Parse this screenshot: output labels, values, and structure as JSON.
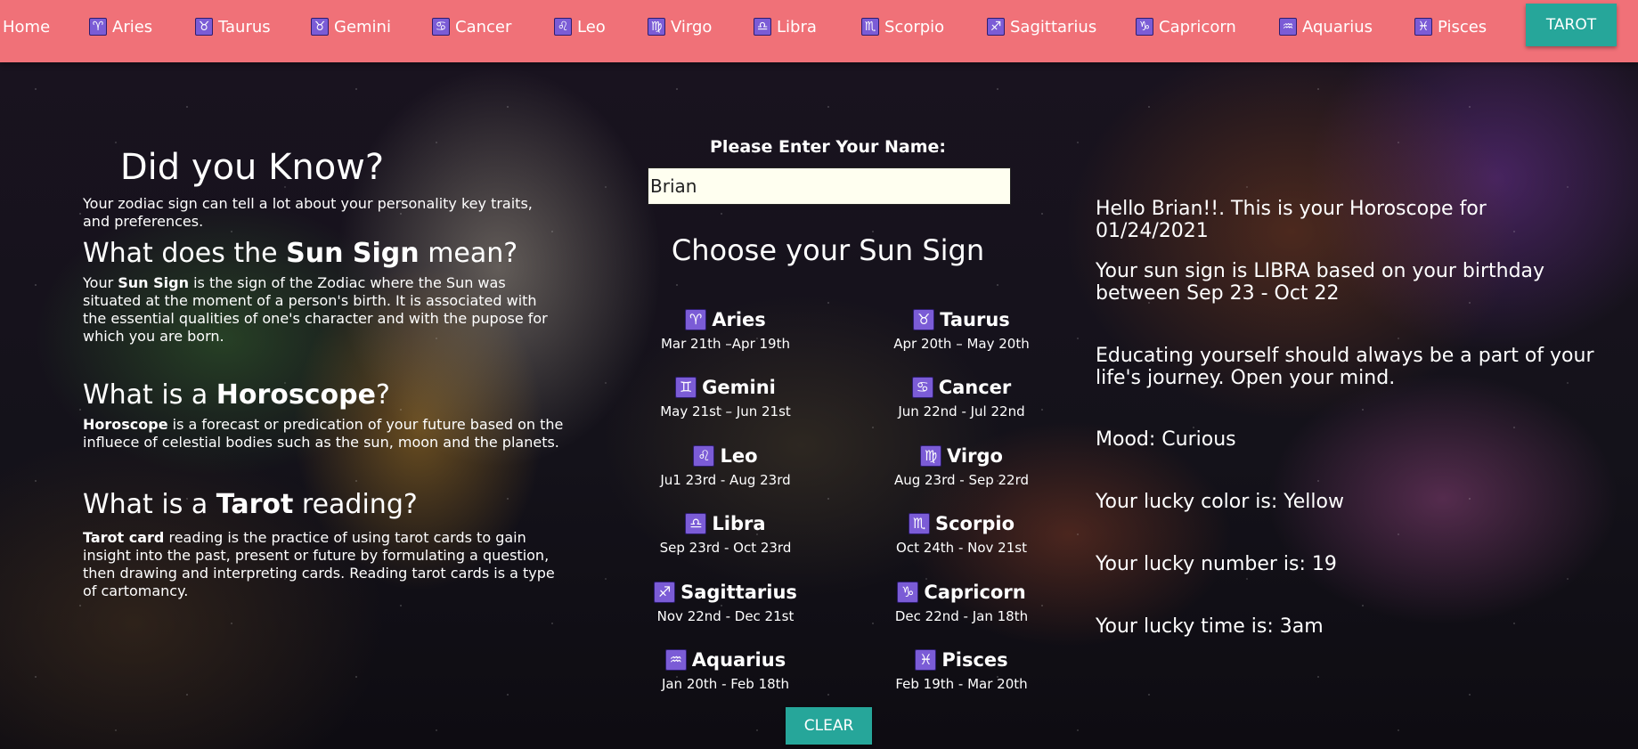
{
  "nav": {
    "home": "Home",
    "signs": [
      {
        "label": "Aries",
        "glyph": "♈"
      },
      {
        "label": "Taurus",
        "glyph": "♉"
      },
      {
        "label": "Gemini",
        "glyph": "♉"
      },
      {
        "label": "Cancer",
        "glyph": "♋"
      },
      {
        "label": "Leo",
        "glyph": "♌"
      },
      {
        "label": "Virgo",
        "glyph": "♍"
      },
      {
        "label": "Libra",
        "glyph": "♎"
      },
      {
        "label": "Scorpio",
        "glyph": "♏"
      },
      {
        "label": "Sagittarius",
        "glyph": "♐"
      },
      {
        "label": "Capricorn",
        "glyph": "♑"
      },
      {
        "label": "Aquarius",
        "glyph": "♒"
      },
      {
        "label": "Pisces",
        "glyph": "♓"
      }
    ],
    "tarot": "TAROT",
    "bar_color": "#f07178",
    "button_color": "#26a69a",
    "icon_color": "#7b5cd6"
  },
  "info": {
    "title": "Did you Know?",
    "intro": "Your zodiac sign can tell a lot about your personality key traits, and preferences.",
    "sun_heading_pre": "What does the ",
    "sun_heading_bold": "Sun Sign",
    "sun_heading_post": " mean?",
    "sun_text_pre": "Your ",
    "sun_text_bold": "Sun Sign",
    "sun_text_post": " is the sign of the Zodiac where the Sun was situated at the moment of a person's birth. It is associated with the essential qualities of one's character and with the pupose for which you are born.",
    "horo_heading_pre": "What is a ",
    "horo_heading_bold": "Horoscope",
    "horo_heading_post": "?",
    "horo_text_bold": "Horoscope",
    "horo_text_post": " is a forecast or predication of your future based on the influece of celestial bodies such as the sun, moon and the planets.",
    "tarot_heading_pre": "What is a ",
    "tarot_heading_bold": "Tarot",
    "tarot_heading_post": " reading?",
    "tarot_text_bold": "Tarot card",
    "tarot_text_post": " reading is the practice of using tarot cards to gain insight into the past, present or future by formulating a question, then drawing and interpreting cards. Reading tarot cards is a type of cartomancy."
  },
  "form": {
    "name_label": "Please Enter Your Name:",
    "name_value": "Brian",
    "choose_title": "Choose your Sun Sign",
    "clear": "CLEAR"
  },
  "signs": [
    {
      "name": "Aries",
      "glyph": "♈",
      "dates": "Mar 21th –Apr 19th"
    },
    {
      "name": "Taurus",
      "glyph": "♉",
      "dates": "Apr 20th – May 20th"
    },
    {
      "name": "Gemini",
      "glyph": "♊",
      "dates": "May 21st – Jun 21st"
    },
    {
      "name": "Cancer",
      "glyph": "♋",
      "dates": "Jun 22nd - Jul 22nd"
    },
    {
      "name": "Leo",
      "glyph": "♌",
      "dates": "Ju1 23rd - Aug 23rd"
    },
    {
      "name": "Virgo",
      "glyph": "♍",
      "dates": "Aug 23rd - Sep 22rd"
    },
    {
      "name": "Libra",
      "glyph": "♎",
      "dates": "Sep 23rd - Oct 23rd"
    },
    {
      "name": "Scorpio",
      "glyph": "♏",
      "dates": "Oct 24th - Nov 21st"
    },
    {
      "name": "Sagittarius",
      "glyph": "♐",
      "dates": "Nov 22nd - Dec 21st"
    },
    {
      "name": "Capricorn",
      "glyph": "♑",
      "dates": "Dec 22nd - Jan 18th"
    },
    {
      "name": "Aquarius",
      "glyph": "♒",
      "dates": "Jan 20th - Feb 18th"
    },
    {
      "name": "Pisces",
      "glyph": "♓",
      "dates": "Feb 19th - Mar 20th"
    }
  ],
  "result": {
    "greeting": "Hello Brian!!. This is your Horoscope for 01/24/2021",
    "sun_sign": "Your sun sign is LIBRA based on your birthday between Sep 23 - Oct 22",
    "message": "Educating yourself should always be a part of your life's journey. Open your mind.",
    "mood": "Mood: Curious",
    "color": "Your lucky color is: Yellow",
    "number": "Your lucky number is: 19",
    "time": "Your lucky time is: 3am"
  }
}
